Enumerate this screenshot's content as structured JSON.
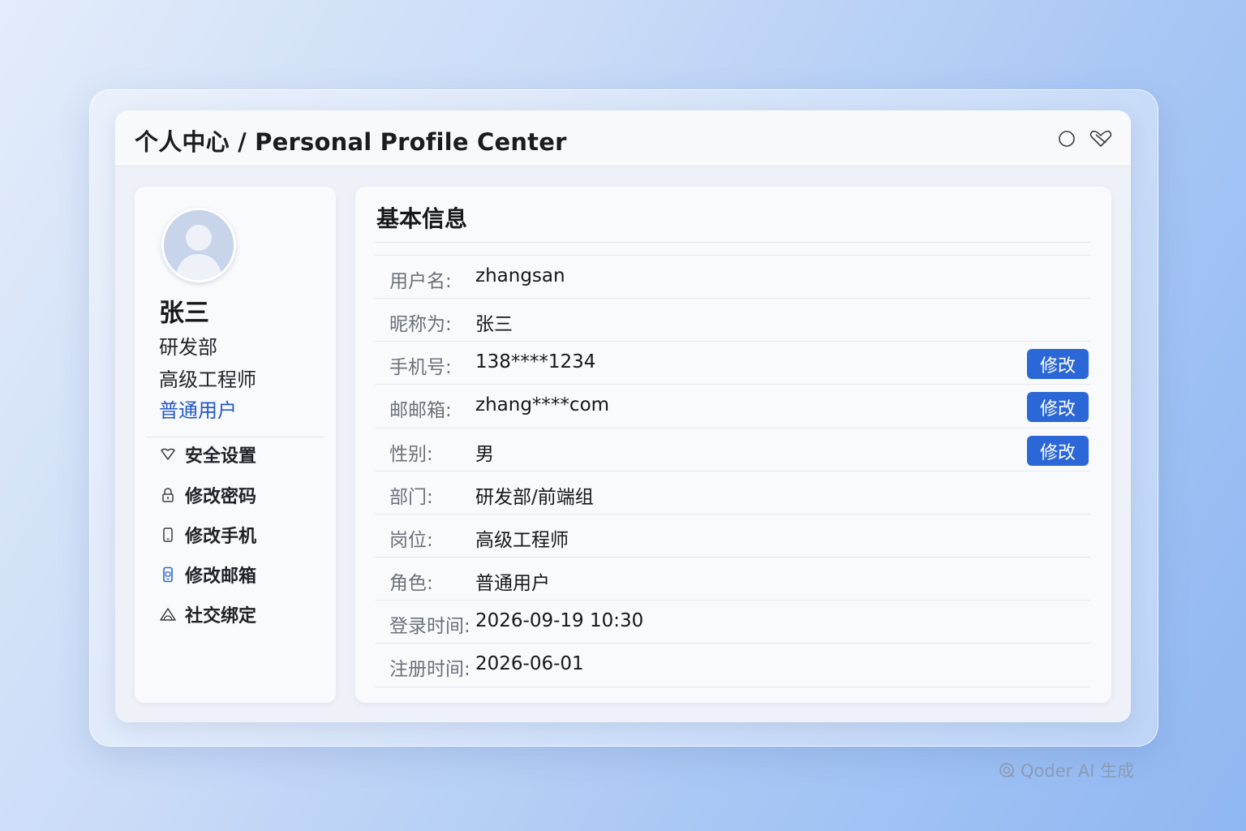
{
  "window": {
    "title": "个人中心 / Personal Profile Center",
    "controls": [
      "circle-icon",
      "heart-icon"
    ]
  },
  "profile": {
    "name": "张三",
    "department": "研发部",
    "job_title": "高级工程师",
    "role": "普通用户"
  },
  "menu": {
    "items": [
      {
        "label": "安全设置",
        "icon": "shield-icon"
      },
      {
        "label": "修改密码",
        "icon": "lock-icon"
      },
      {
        "label": "修改手机",
        "icon": "phone-icon"
      },
      {
        "label": "修改邮箱",
        "icon": "mobile-mail-icon"
      },
      {
        "label": "社交绑定",
        "icon": "triangle-icon"
      }
    ]
  },
  "basic_info": {
    "title": "基本信息",
    "edit_label": "修改",
    "rows": [
      {
        "label": "用户名:",
        "value": "zhangsan",
        "editable": false
      },
      {
        "label": "昵称为:",
        "value": "张三",
        "editable": false
      },
      {
        "label": "手机号:",
        "value": "138****1234",
        "editable": true
      },
      {
        "label": "邮邮箱:",
        "value": "zhang****com",
        "editable": true
      },
      {
        "label": "性别:",
        "value": "男",
        "editable": true
      },
      {
        "label": "部门:",
        "value": "研发部/前端组",
        "editable": false
      },
      {
        "label": "岗位:",
        "value": "高级工程师",
        "editable": false
      },
      {
        "label": "角色:",
        "value": "普通用户",
        "editable": false
      },
      {
        "label": "登录时间:",
        "value": "2026-09-19 10:30",
        "editable": false
      },
      {
        "label": "注册时间:",
        "value": "2026-06-01",
        "editable": false
      }
    ]
  },
  "watermark": {
    "text": "Qoder AI 生成"
  },
  "colors": {
    "accent": "#2b67d6",
    "role_text": "#2358c9",
    "label_text": "#6c717a"
  }
}
